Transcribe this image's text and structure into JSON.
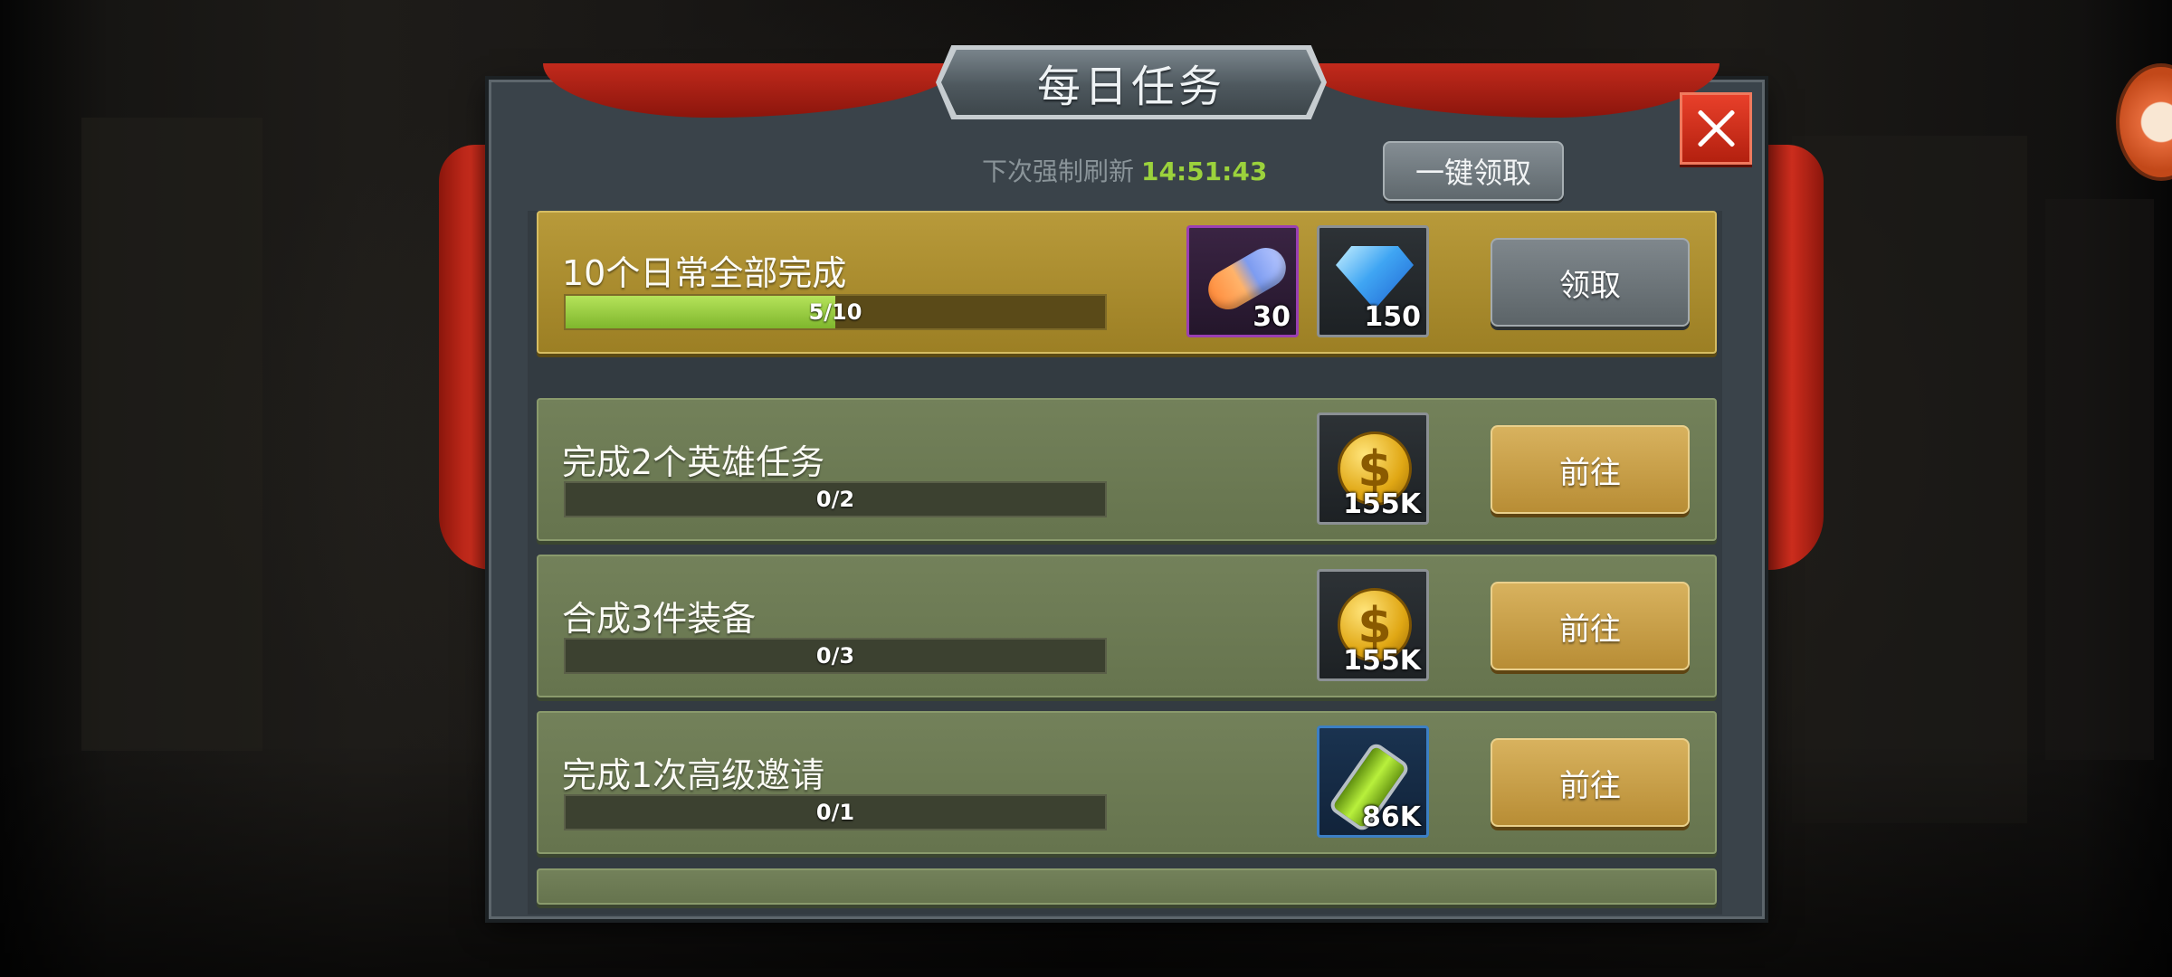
{
  "window": {
    "title": "每日任务"
  },
  "header": {
    "refresh_label": "下次强制刷新",
    "refresh_time": "14:51:43",
    "claim_all_label": "一键领取"
  },
  "summary_task": {
    "name": "10个日常全部完成",
    "progress_text": "5/10",
    "progress": 0.5,
    "rewards": [
      {
        "icon": "capsule-icon",
        "count": "30"
      },
      {
        "icon": "gem-icon",
        "count": "150"
      }
    ],
    "button_label": "领取"
  },
  "tasks": [
    {
      "name": "完成2个英雄任务",
      "progress_text": "0/2",
      "progress": 0,
      "reward_icon": "coin-icon",
      "reward_count": "155K",
      "button_label": "前往"
    },
    {
      "name": "合成3件装备",
      "progress_text": "0/3",
      "progress": 0,
      "reward_icon": "coin-icon",
      "reward_count": "155K",
      "button_label": "前往"
    },
    {
      "name": "完成1次高级邀请",
      "progress_text": "0/1",
      "progress": 0,
      "reward_icon": "tube-icon",
      "reward_count": "86K",
      "button_label": "前往"
    }
  ],
  "icons": {
    "close": "close-icon",
    "paw": "paw-icon",
    "coin_symbol": "$"
  },
  "colors": {
    "accent_green": "#9bd23c",
    "close_red": "#d32d19",
    "gold_row": "#b89a3a"
  }
}
